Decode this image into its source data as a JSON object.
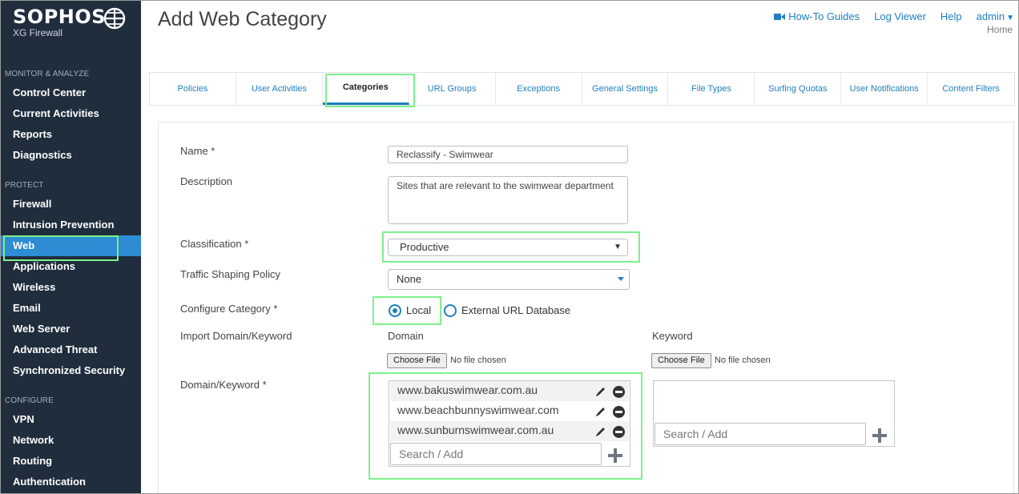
{
  "brand": {
    "name": "SOPHOS",
    "product": "XG Firewall"
  },
  "sidebar": {
    "sections": [
      {
        "label": "MONITOR & ANALYZE",
        "items": [
          "Control Center",
          "Current Activities",
          "Reports",
          "Diagnostics"
        ]
      },
      {
        "label": "PROTECT",
        "items": [
          "Firewall",
          "Intrusion Prevention",
          "Web",
          "Applications",
          "Wireless",
          "Email",
          "Web Server",
          "Advanced Threat",
          "Synchronized Security"
        ]
      },
      {
        "label": "CONFIGURE",
        "items": [
          "VPN",
          "Network",
          "Routing",
          "Authentication"
        ]
      }
    ],
    "active": "Web"
  },
  "header": {
    "title": "Add Web Category",
    "links": {
      "howto": "How-To Guides",
      "log_viewer": "Log Viewer",
      "help": "Help",
      "admin": "admin"
    },
    "home": "Home"
  },
  "tabs": [
    "Policies",
    "User Activities",
    "Categories",
    "URL Groups",
    "Exceptions",
    "General Settings",
    "File Types",
    "Surfing Quotas",
    "User Notifications",
    "Content Filters"
  ],
  "active_tab": "Categories",
  "form": {
    "name_label": "Name *",
    "name_value": "Reclassify - Swimwear",
    "description_label": "Description",
    "description_value": "Sites that are relevant to the swimwear department",
    "classification_label": "Classification *",
    "classification_value": "Productive",
    "traffic_label": "Traffic Shaping Policy",
    "traffic_value": "None",
    "configure_label": "Configure Category *",
    "configure_options": {
      "local": "Local",
      "external": "External URL Database"
    },
    "configure_selected": "Local",
    "import_label": "Import Domain/Keyword",
    "domain_header": "Domain",
    "keyword_header": "Keyword",
    "choose_file": "Choose File",
    "no_file": "No file chosen",
    "domain_keyword_label": "Domain/Keyword *",
    "domains": [
      "www.bakuswimwear.com.au",
      "www.beachbunnyswimwear.com",
      "www.sunburnswimwear.com.au"
    ],
    "search_placeholder": "Search / Add"
  },
  "colors": {
    "sidebar_bg": "#1f2d3d",
    "accent": "#1f7fc1",
    "active_nav": "#2d8cd4",
    "highlight": "#7ef08a"
  }
}
